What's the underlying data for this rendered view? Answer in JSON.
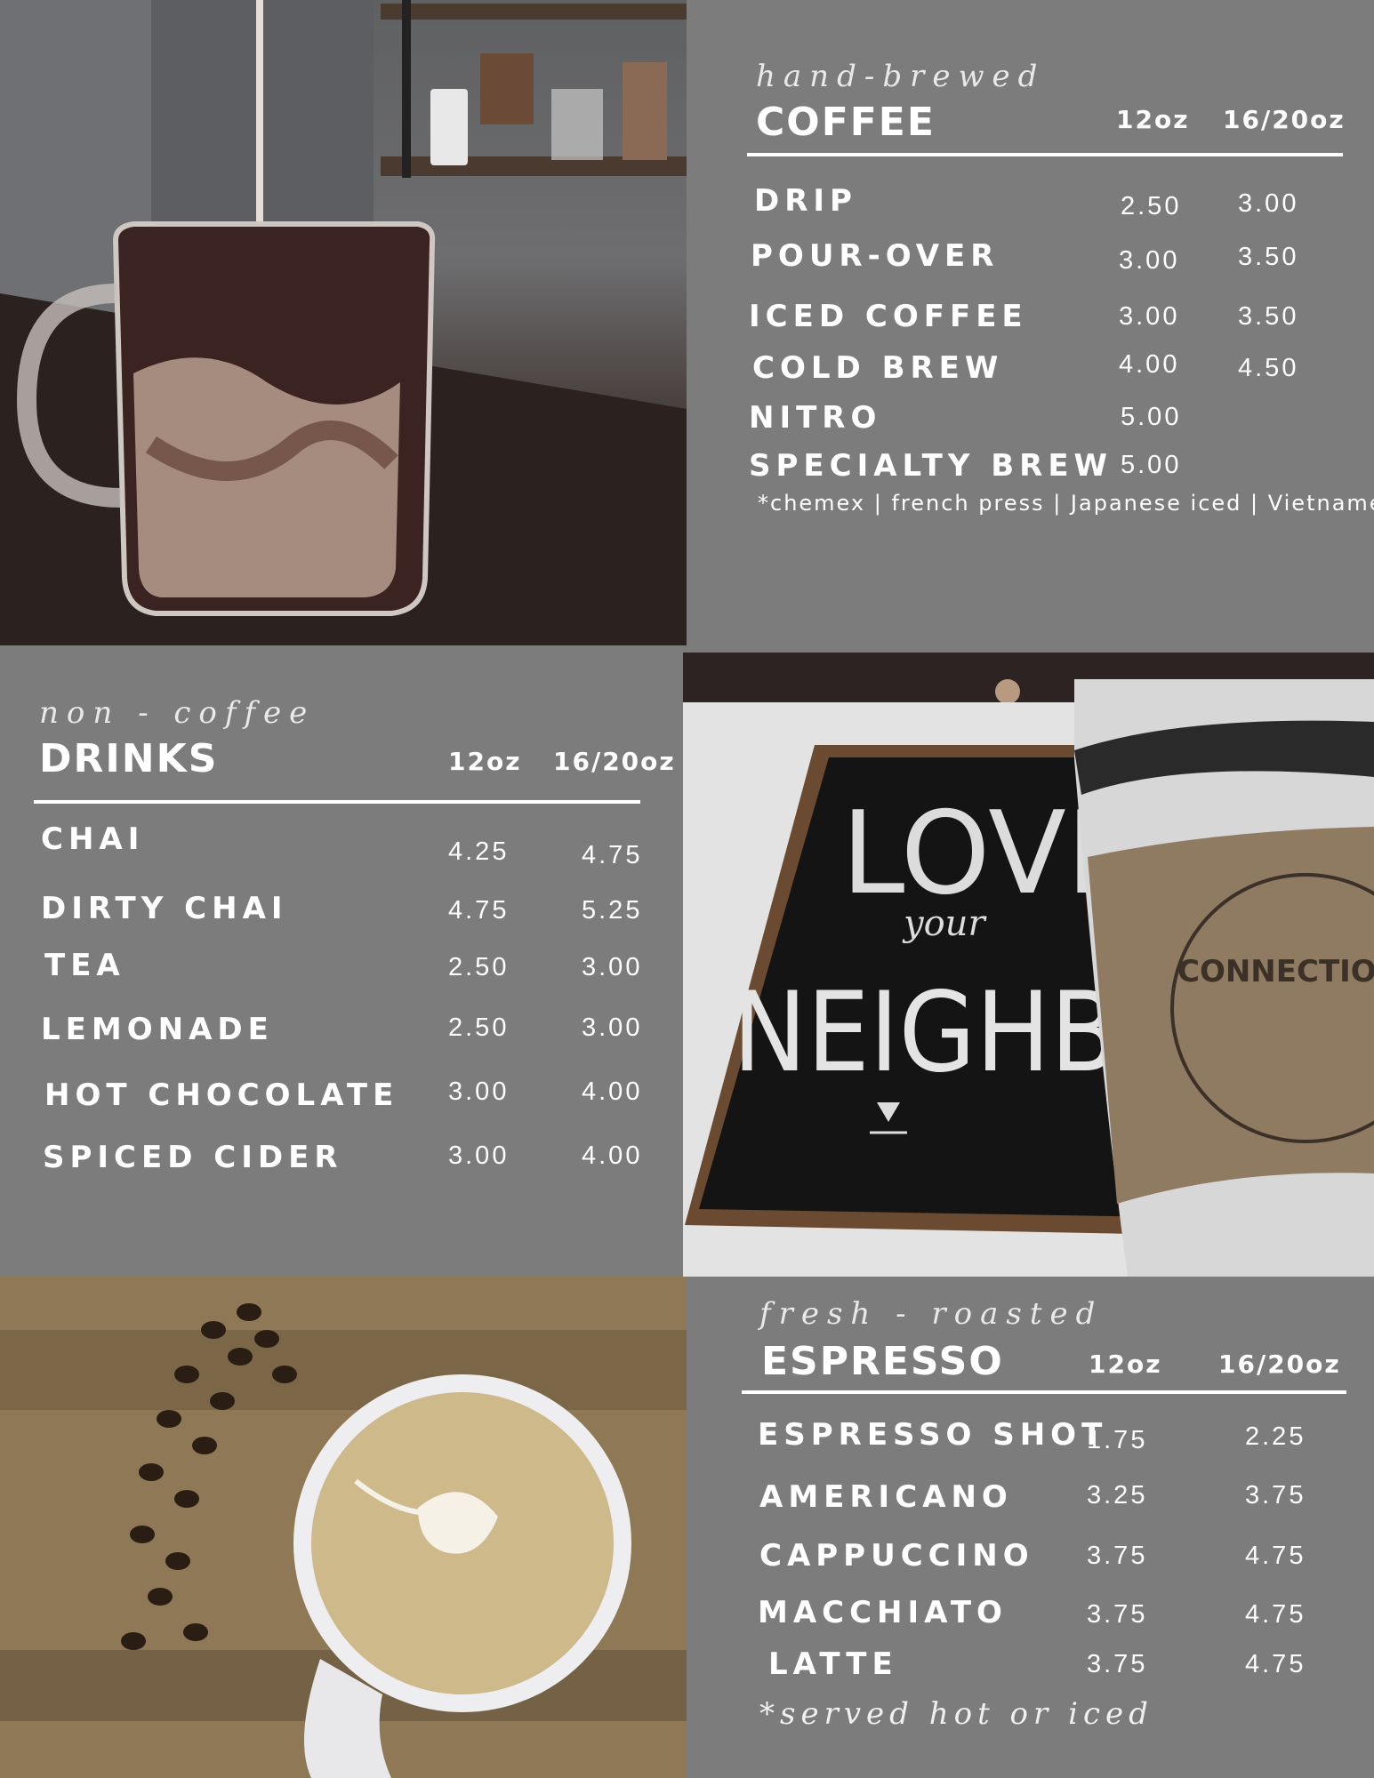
{
  "coffee": {
    "script_title": "hand-brewed",
    "title": "COFFEE",
    "size_small": "12oz",
    "size_large": "16/20oz",
    "items": [
      {
        "name": "DRIP",
        "small": "2.50",
        "large": "3.00"
      },
      {
        "name": "POUR-OVER",
        "small": "3.00",
        "large": "3.50"
      },
      {
        "name": "ICED COFFEE",
        "small": "3.00",
        "large": "3.50"
      },
      {
        "name": "COLD BREW",
        "small": "4.00",
        "large": "4.50"
      },
      {
        "name": "NITRO",
        "small": "5.00",
        "large": ""
      },
      {
        "name": "SPECIALTY BREW",
        "small": "5.00",
        "large": ""
      }
    ],
    "note": "*chemex | french press | Japanese iced | Vietnamese"
  },
  "drinks": {
    "script_title": "non - coffee",
    "title": "DRINKS",
    "size_small": "12oz",
    "size_large": "16/20oz",
    "items": [
      {
        "name": "CHAI",
        "small": "4.25",
        "large": "4.75"
      },
      {
        "name": "DIRTY CHAI",
        "small": "4.75",
        "large": "5.25"
      },
      {
        "name": "TEA",
        "small": "2.50",
        "large": "3.00"
      },
      {
        "name": "LEMONADE",
        "small": "2.50",
        "large": "3.00"
      },
      {
        "name": "HOT CHOCOLATE",
        "small": "3.00",
        "large": "4.00"
      },
      {
        "name": "SPICED CIDER",
        "small": "3.00",
        "large": "4.00"
      }
    ]
  },
  "espresso": {
    "script_title": "fresh - roasted",
    "title": "ESPRESSO",
    "size_small": "12oz",
    "size_large": "16/20oz",
    "items": [
      {
        "name": "ESPRESSO SHOT",
        "small": "1.75",
        "large": "2.25"
      },
      {
        "name": "AMERICANO",
        "small": "3.25",
        "large": "3.75"
      },
      {
        "name": "CAPPUCCINO",
        "small": "3.75",
        "large": "4.75"
      },
      {
        "name": "MACCHIATO",
        "small": "3.75",
        "large": "4.75"
      },
      {
        "name": "LATTE",
        "small": "3.75",
        "large": "4.75"
      }
    ],
    "note": "*served hot or iced"
  },
  "sign": {
    "line1": "LOVE",
    "line2": "your",
    "line3": "NEIGHBOR",
    "cup_logo": "CONNECTIONS"
  }
}
